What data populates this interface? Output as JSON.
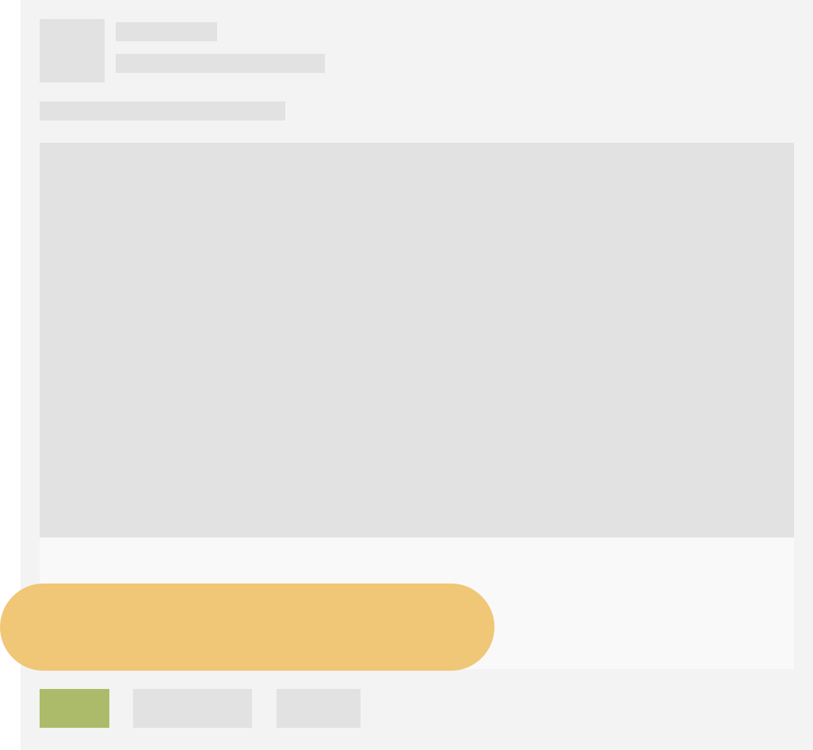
{
  "post_card": {
    "author_name": "",
    "author_meta": "",
    "text": ""
  },
  "actions": {
    "primary_label": "",
    "secondary_label": "",
    "tertiary_label": ""
  },
  "overlay": {
    "label": ""
  },
  "colors": {
    "card_background": "#f3f3f3",
    "placeholder": "#e2e2e2",
    "media_footer": "#f9f9f9",
    "primary_action": "#acbb69",
    "overlay_pill": "#f0c677"
  }
}
